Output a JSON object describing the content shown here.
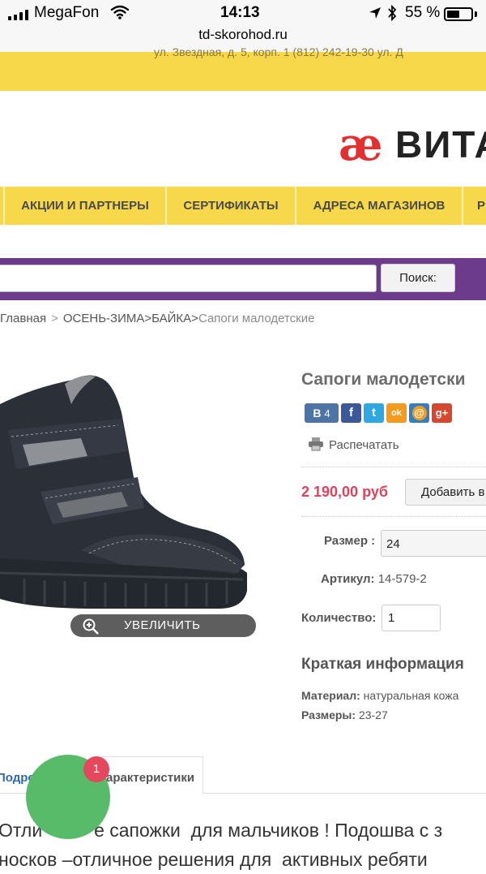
{
  "status_bar": {
    "carrier": "MegaFon",
    "time": "14:13",
    "url": "td-skorohod.ru",
    "battery_percent": "55 %",
    "battery_level": 0.55
  },
  "top_bar": {
    "address": "ул. Звездная, д. 5, корп. 1 (812) 242-19-30     ул. Д"
  },
  "header": {
    "logo_mark": "æ",
    "logo_text": "ВИТА"
  },
  "nav": {
    "items": [
      {
        "label": "АКЦИИ И ПАРТНЕРЫ"
      },
      {
        "label": "СЕРТИФИКАТЫ"
      },
      {
        "label": "АДРЕСА МАГАЗИНОВ"
      },
      {
        "label": "Р"
      }
    ]
  },
  "search": {
    "value": "",
    "button_label": "Поиск:"
  },
  "breadcrumb": {
    "home": "Главная",
    "sep": ">",
    "path": "ОСЕНЬ-ЗИМА>БАЙКА>",
    "current": "Сапоги малодетские"
  },
  "product": {
    "zoom_label": "УВЕЛИЧИТЬ",
    "title": "Сапоги малодетски",
    "share": {
      "vk_label": "В",
      "vk_count": "4",
      "fb_label": "f",
      "tw_label": "t",
      "ok_label": "ok",
      "mail_label": "@",
      "gplus_label": "g+"
    },
    "print_label": "Распечатать",
    "price": "2 190,00 руб",
    "add_to_cart": "Добавить в",
    "size_label": "Размер :",
    "size_value": "24",
    "article_label": "Артикул:",
    "article_value": "14-579-2",
    "qty_label": "Количество:",
    "qty_value": "1",
    "brief_title": "Краткая информация",
    "material_label": "Материал:",
    "material_value": "натуральная кожа",
    "sizes_label": "Размеры:",
    "sizes_value": "23-27"
  },
  "tabs": {
    "details": "Подроб",
    "specs": "арактеристики"
  },
  "description": {
    "line1": "Отли          е сапожки  для мальчиков ! Подошва с з",
    "line2": "носков –отличное решения для  активных ребяти"
  },
  "chat": {
    "badge_count": "1"
  },
  "colors": {
    "yellow": "#f7d84a",
    "purple": "#6d3b8b",
    "price_red": "#e0425e",
    "chat_green": "#57bb6a",
    "badge_red": "#e5485d",
    "link_blue": "#2d6aa8"
  }
}
